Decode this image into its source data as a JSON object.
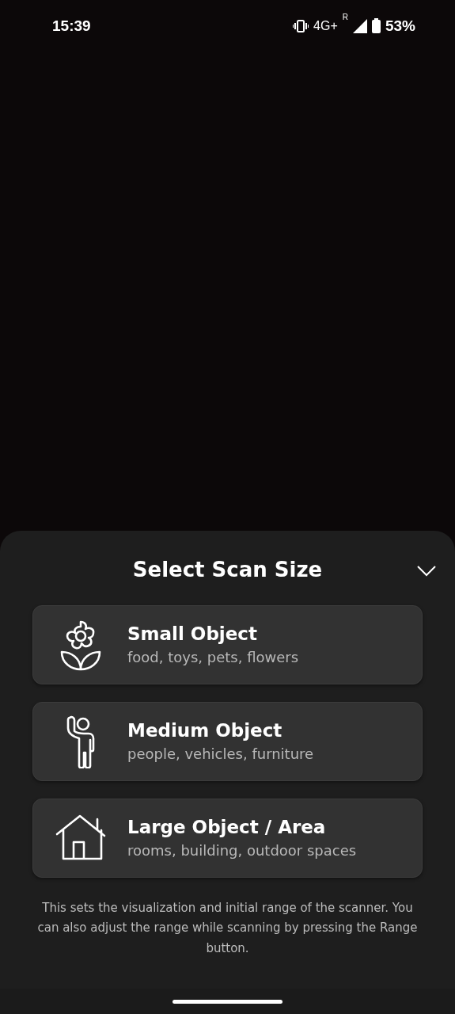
{
  "status_bar": {
    "time": "15:39",
    "network": "4G+",
    "roaming": "R",
    "battery": "53%"
  },
  "sheet": {
    "title": "Select Scan Size",
    "options": [
      {
        "kind": "flower",
        "title": "Small Object",
        "subtitle": "food, toys, pets, flowers"
      },
      {
        "kind": "person",
        "title": "Medium Object",
        "subtitle": "people, vehicles, furniture"
      },
      {
        "kind": "house",
        "title": "Large Object / Area",
        "subtitle": "rooms, building, outdoor spaces"
      }
    ],
    "note": "This sets the visualization and initial range of the scanner. You can also adjust the range while scanning by pressing the Range button."
  }
}
